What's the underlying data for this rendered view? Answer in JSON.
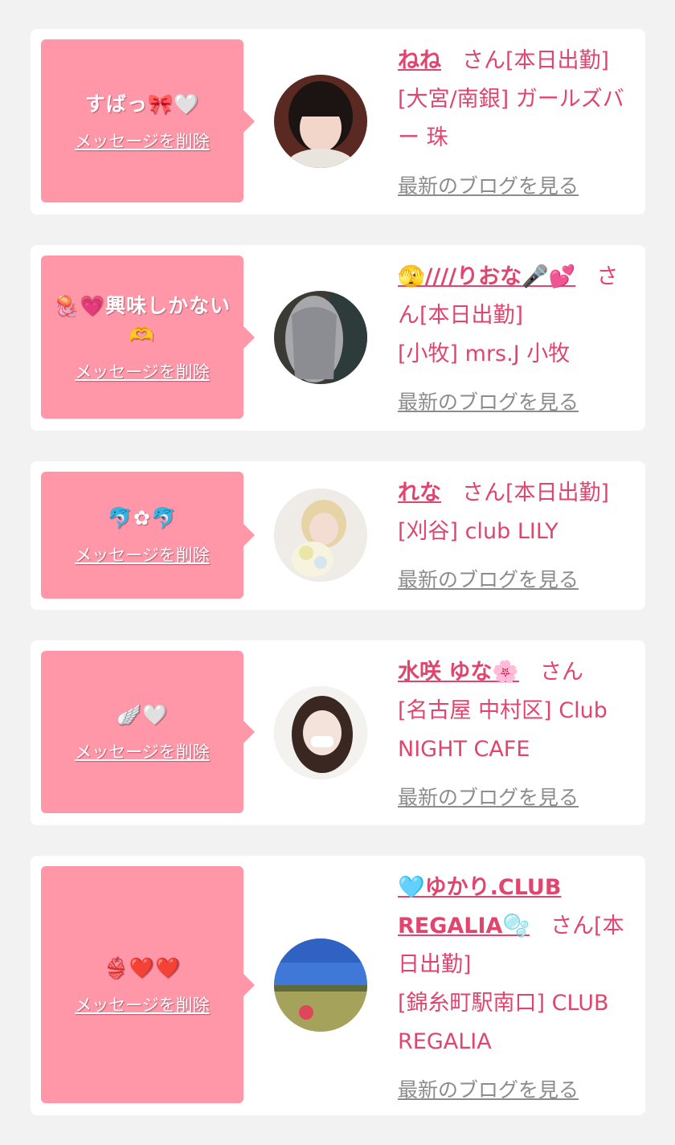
{
  "posts": [
    {
      "message": "すばっ🎀🤍",
      "delete_label": "メッセージを削除",
      "name": "ねね",
      "san": "さん[本日出勤]",
      "shop": "[大宮/南銀] ガールズバー 珠",
      "blog_label": "最新のブログを見る"
    },
    {
      "message": "🪼💗興味しかない🫶",
      "delete_label": "メッセージを削除",
      "name": "🫣////りおな🎤💕",
      "san": "さん[本日出勤]",
      "shop": "[小牧] mrs.J 小牧",
      "blog_label": "最新のブログを見る"
    },
    {
      "message": "🐬✿🐬",
      "delete_label": "メッセージを削除",
      "name": "れな",
      "san": "さん[本日出勤]",
      "shop": "[刈谷] club LILY",
      "blog_label": "最新のブログを見る"
    },
    {
      "message": "🪽🤍",
      "delete_label": "メッセージを削除",
      "name": "水咲 ゆな🌸",
      "san": "さん",
      "shop": "[名古屋 中村区] Club NIGHT CAFE",
      "blog_label": "最新のブログを見る"
    },
    {
      "message": "👙❤️❤️",
      "delete_label": "メッセージを削除",
      "name": "🩵ゆかり.CLUB REGALIA🫧",
      "san": "さん[本日出勤]",
      "shop": "[錦糸町駅南口] CLUB REGALIA",
      "blog_label": "最新のブログを見る"
    }
  ]
}
